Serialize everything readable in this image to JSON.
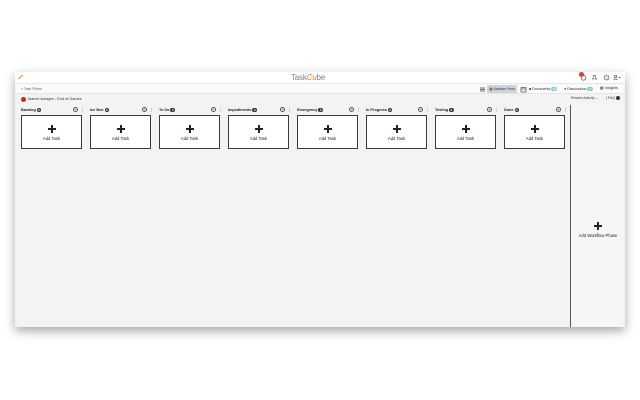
{
  "header": {
    "logo": {
      "part1": "Task",
      "part2": "Cu",
      "part3": "be"
    },
    "notification_badge": "!",
    "icons": [
      "notification-icon",
      "bell-icon",
      "help-icon",
      "user-menu-icon"
    ]
  },
  "toolbar": {
    "filter_label": "Task Filters",
    "kanban_label": "Kanban View",
    "documents_label": "Documents",
    "documents_count": "30",
    "discussions_label": "Discussions",
    "discussions_count": "0",
    "insights_label": "Insights"
  },
  "project": {
    "title": "Marcel Avingen - End of Games",
    "recent_activity": "Recent Activity",
    "faq": "| FAQ"
  },
  "columns": [
    {
      "name": "Backlog",
      "count": "0",
      "add_label": "Add Task"
    },
    {
      "name": "Ice Box",
      "count": "0",
      "add_label": "Add Task"
    },
    {
      "name": "To Do",
      "count": "0",
      "add_label": "Add Task"
    },
    {
      "name": "Impediments",
      "count": "0",
      "add_label": "Add Task"
    },
    {
      "name": "Emergency",
      "count": "0",
      "add_label": "Add Task"
    },
    {
      "name": "In Progress",
      "count": "0",
      "add_label": "Add Task"
    },
    {
      "name": "Testing",
      "count": "0",
      "add_label": "Add Task"
    },
    {
      "name": "Done",
      "count": "0",
      "add_label": "Add Task"
    }
  ],
  "workflow": {
    "add_label": "Add Workflow Phase"
  },
  "colors": {
    "accent": "#f07c22",
    "dark": "#2a3647",
    "badge": "#e53935",
    "teal": "#7fd1c6"
  }
}
